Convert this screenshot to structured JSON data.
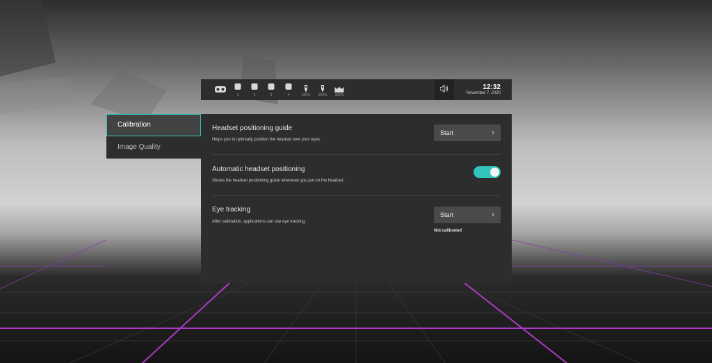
{
  "topbar": {
    "items": [
      {
        "icon": "vr-headset-icon",
        "label": ""
      },
      {
        "icon": "desktop-1-icon",
        "label": "1"
      },
      {
        "icon": "desktop-2-icon",
        "label": "2"
      },
      {
        "icon": "desktop-3-icon",
        "label": "3"
      },
      {
        "icon": "desktop-4-icon",
        "label": "4"
      },
      {
        "icon": "left-controller-icon",
        "label": "100%"
      },
      {
        "icon": "right-controller-icon",
        "label": "100%"
      },
      {
        "icon": "headset-battery-icon",
        "label": "100%"
      }
    ],
    "volume_icon": "speaker-icon",
    "time": "12:32",
    "date": "November 7, 2020"
  },
  "sidebar": {
    "tabs": [
      {
        "label": "Calibration",
        "active": true
      },
      {
        "label": "Image Quality",
        "active": false
      }
    ]
  },
  "main": {
    "headset_guide": {
      "title": "Headset positioning guide",
      "description": "Helps you to optimally position the headset over your eyes.",
      "button_label": "Start"
    },
    "auto_positioning": {
      "title": "Automatic headset positioning",
      "description": "Shows the headset positioning guide whenever you put on the headset.",
      "enabled": true
    },
    "eye_tracking": {
      "title": "Eye tracking",
      "description": "After calibration, applications can use eye tracking.",
      "button_label": "Start",
      "status": "Not calibrated"
    }
  },
  "colors": {
    "accent": "#31c4bd",
    "panel": "#2d2d2d",
    "grid_line": "#b33bd0"
  }
}
